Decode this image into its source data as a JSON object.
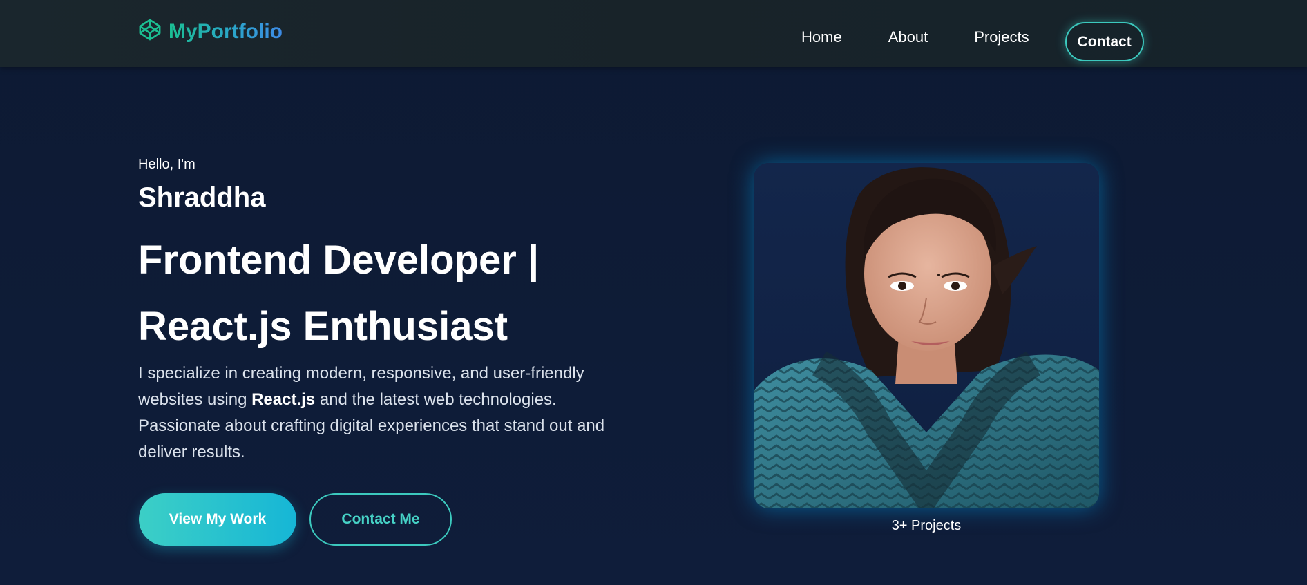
{
  "brand": {
    "name": "MyPortfolio",
    "icon": "codepen-cube-icon"
  },
  "nav": {
    "links": [
      "Home",
      "About",
      "Projects"
    ],
    "contact_label": "Contact"
  },
  "hero": {
    "greeting": "Hello, I'm",
    "name": "Shraddha",
    "headline_line1": "Frontend Developer |",
    "headline_line2": "React.js Enthusiast",
    "description_part1": "I specialize in creating modern, responsive, and user-friendly websites using ",
    "description_bold": "React.js",
    "description_part2": " and the latest web technologies. Passionate about crafting digital experiences that stand out and deliver results.",
    "primary_button": "View My Work",
    "secondary_button": "Contact Me"
  },
  "photo": {
    "caption": "3+ Projects"
  },
  "colors": {
    "accent": "#3cc9be",
    "accent_blue": "#16b6d6",
    "background": "#0e1b33",
    "navbar": "#182329"
  }
}
